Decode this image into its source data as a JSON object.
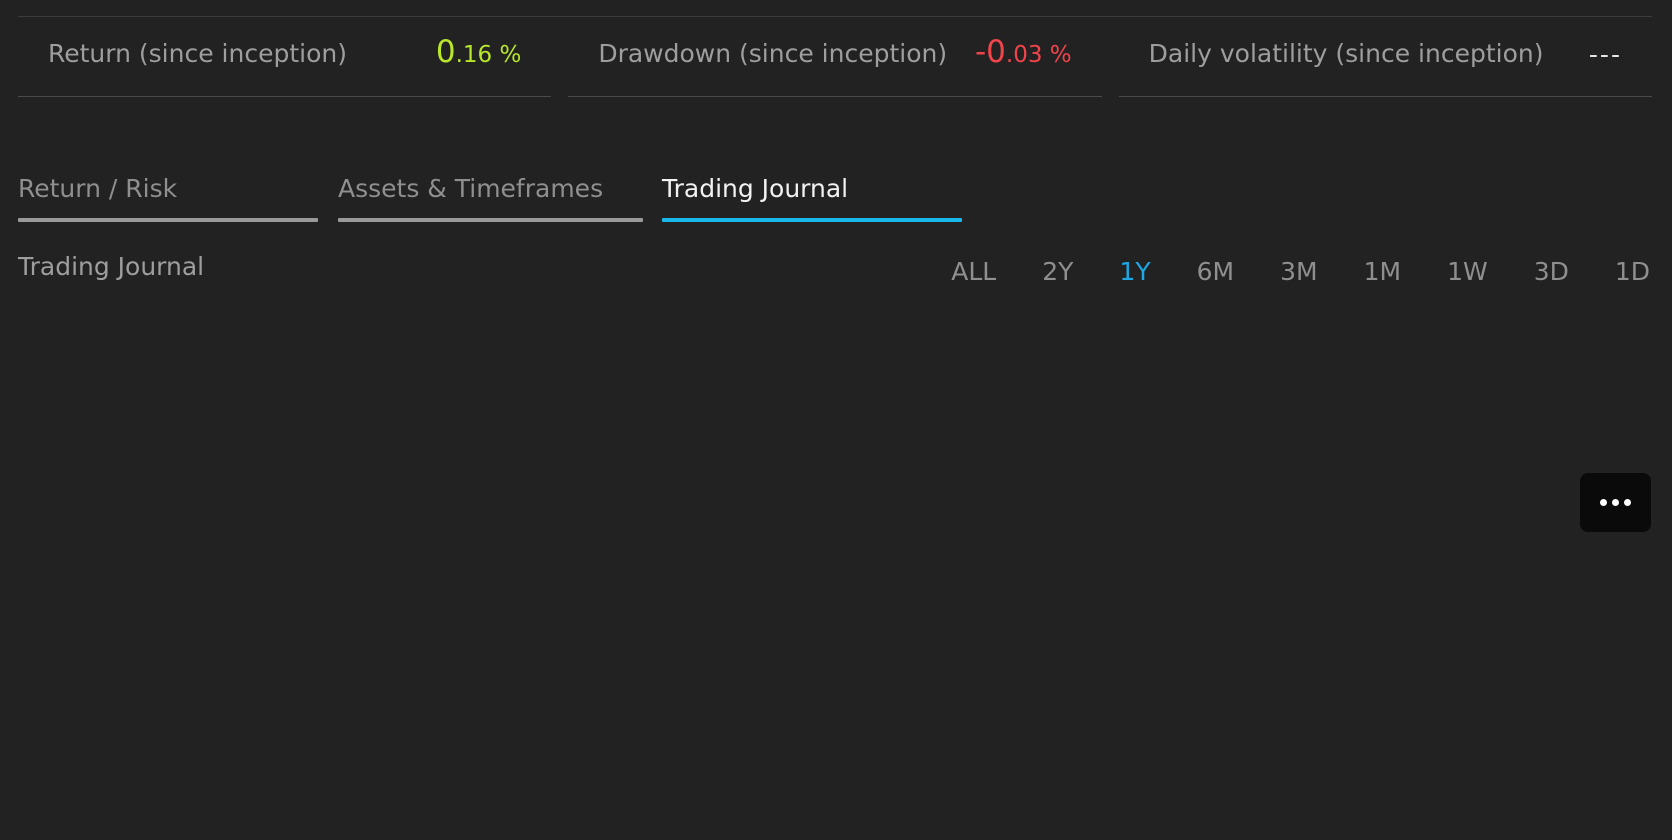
{
  "stats": [
    {
      "label": "Return (since inception)",
      "value_int": "0",
      "value_dec": ".16",
      "unit": " %",
      "color": "#b8e62a"
    },
    {
      "label": "Drawdown (since inception)",
      "value_int": "-0",
      "value_dec": ".03",
      "unit": " %",
      "color": "#f0444a"
    },
    {
      "label": "Daily volatility (since inception)",
      "value_text": "---"
    }
  ],
  "tabs": [
    {
      "label": "Return / Risk"
    },
    {
      "label": "Assets & Timeframes"
    },
    {
      "label": "Trading Journal"
    }
  ],
  "active_tab": "Trading Journal",
  "section_title": "Trading Journal",
  "ranges": [
    "ALL",
    "2Y",
    "1Y",
    "6M",
    "3M",
    "1M",
    "1W",
    "3D",
    "1D"
  ],
  "active_range": "1Y",
  "colors": {
    "background": "#222222",
    "accent": "#1ab8e8",
    "positive": "#b8e62a",
    "negative": "#f0444a"
  },
  "more_button": {
    "icon": "more-horizontal-icon"
  }
}
